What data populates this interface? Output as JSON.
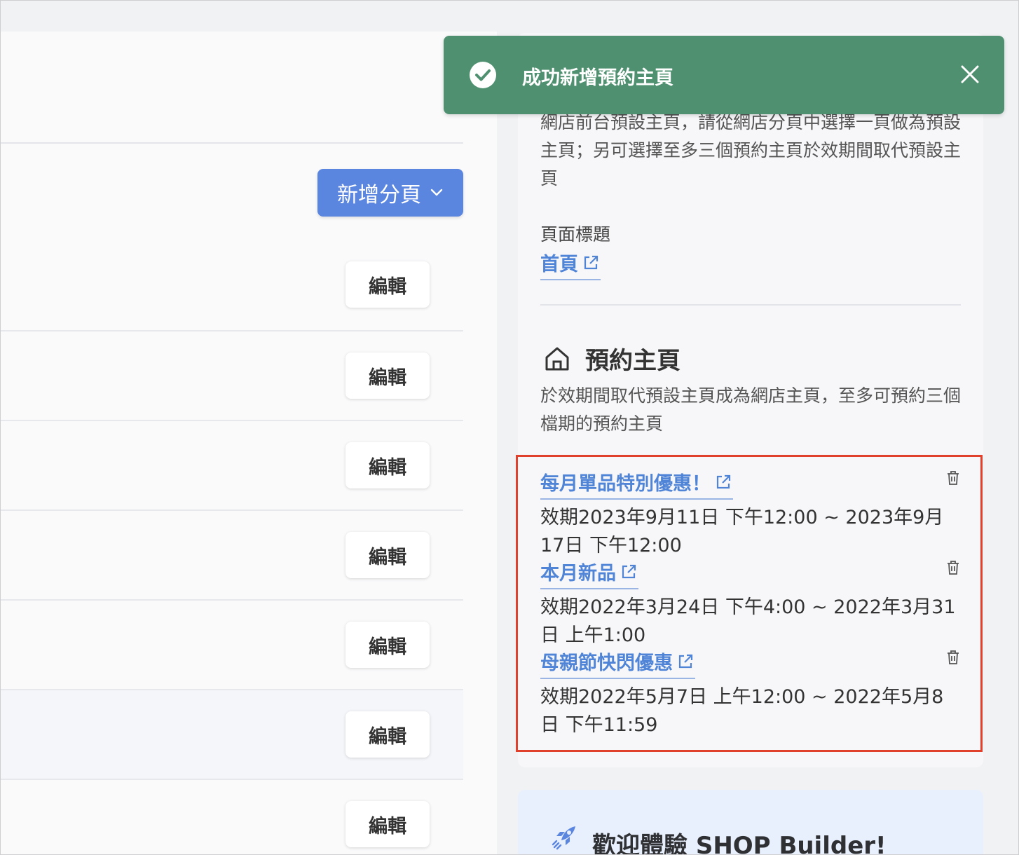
{
  "toast": {
    "message": "成功新增預約主頁",
    "color": "#4e906f"
  },
  "left": {
    "add_page_label": "新增分頁",
    "rows": [
      {
        "edit_label": "編輯"
      },
      {
        "edit_label": "編輯"
      },
      {
        "edit_label": "編輯"
      },
      {
        "edit_label": "編輯"
      },
      {
        "edit_label": "編輯"
      },
      {
        "edit_label": "編輯"
      },
      {
        "edit_label": "編輯"
      }
    ]
  },
  "homepage": {
    "description": "網店前台預設主頁，請從網店分頁中選擇一頁做為預設主頁；另可選擇至多三個預約主頁於效期間取代預設主頁",
    "page_title_label": "頁面標題",
    "page_title_link": "首頁"
  },
  "scheduled": {
    "title": "預約主頁",
    "description": "於效期間取代預設主頁成為網店主頁，至多可預約三個檔期的預約主頁",
    "entries": [
      {
        "name": "每月單品特別優惠！",
        "period": "效期2023年9月11日 下午12:00 ~ 2023年9月17日 下午12:00"
      },
      {
        "name": "本月新品",
        "period": "效期2022年3月24日 下午4:00 ~ 2022年3月31日 上午1:00"
      },
      {
        "name": "母親節快閃優惠",
        "period": "效期2022年5月7日 上午12:00 ~ 2022年5月8日 下午11:59"
      }
    ]
  },
  "welcome": {
    "text": "歡迎體驗 SHOP Builder!"
  },
  "colors": {
    "accent": "#5b86e0",
    "link": "#4f84d6",
    "highlight_border": "#e0412d"
  }
}
